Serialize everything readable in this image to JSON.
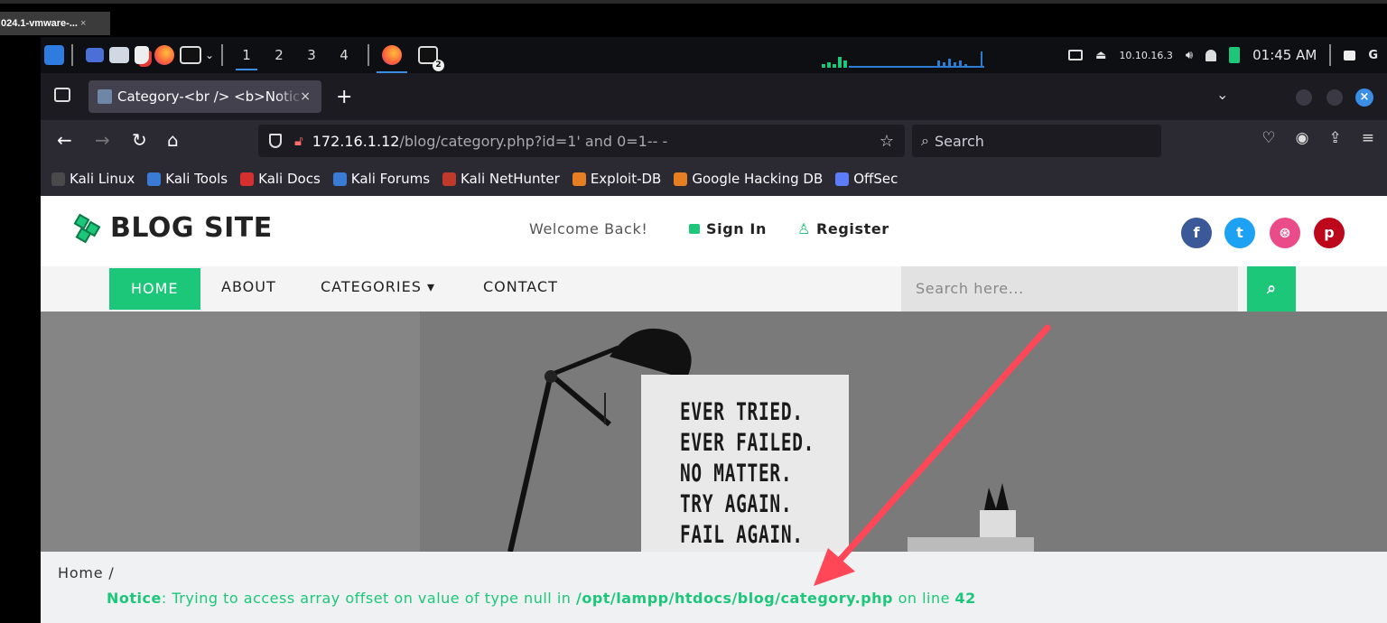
{
  "host": {
    "tab_title": "024.1-vmware-...",
    "tab_close": "×"
  },
  "panel": {
    "workspaces": [
      "1",
      "2",
      "3",
      "4"
    ],
    "terminal_badge": "2",
    "ip": "10.10.16.3",
    "clock": "01:45 AM"
  },
  "browser": {
    "tab_title": "Category-<br /> <b>Notic",
    "tab_close": "×",
    "new_tab": "+",
    "url_host": "172.16.1.12",
    "url_path": "/blog/category.php?id=1' and 0=1-- -",
    "search_placeholder": "Search"
  },
  "bookmarks": [
    {
      "label": "Kali Linux",
      "color": "#4a4a4a"
    },
    {
      "label": "Kali Tools",
      "color": "#3a7bd5"
    },
    {
      "label": "Kali Docs",
      "color": "#d62f2f"
    },
    {
      "label": "Kali Forums",
      "color": "#3a7bd5"
    },
    {
      "label": "Kali NetHunter",
      "color": "#c0392b"
    },
    {
      "label": "Exploit-DB",
      "color": "#e67e22"
    },
    {
      "label": "Google Hacking DB",
      "color": "#e67e22"
    },
    {
      "label": "OffSec",
      "color": "#5c7cfa"
    }
  ],
  "site": {
    "logo": "BLOG SITE",
    "welcome": "Welcome Back!",
    "sign_in": "Sign In",
    "register": "Register",
    "social": [
      {
        "icon": "facebook-icon",
        "glyph": "f",
        "color": "#3b5998"
      },
      {
        "icon": "twitter-icon",
        "glyph": "t",
        "color": "#1da1f2"
      },
      {
        "icon": "dribbble-icon",
        "glyph": "⊛",
        "color": "#ea4c89"
      },
      {
        "icon": "pinterest-icon",
        "glyph": "p",
        "color": "#bd081c"
      }
    ],
    "menu": [
      "HOME",
      "ABOUT",
      "CATEGORIES ▾",
      "CONTACT"
    ],
    "search_placeholder": "Search here...",
    "hero_text": [
      "EVER TRIED.",
      "EVER FAILED.",
      "NO MATTER.",
      "TRY AGAIN.",
      "FAIL AGAIN."
    ],
    "breadcrumb": "Home  /",
    "notice": {
      "label": "Notice",
      "message": ": Trying to access array offset on value of type null in ",
      "file": "/opt/lampp/htdocs/blog/category.php",
      "line_text": " on line ",
      "line": "42"
    }
  },
  "colors": {
    "accent": "#1cc779",
    "annotation_arrow": "#ff4757"
  }
}
